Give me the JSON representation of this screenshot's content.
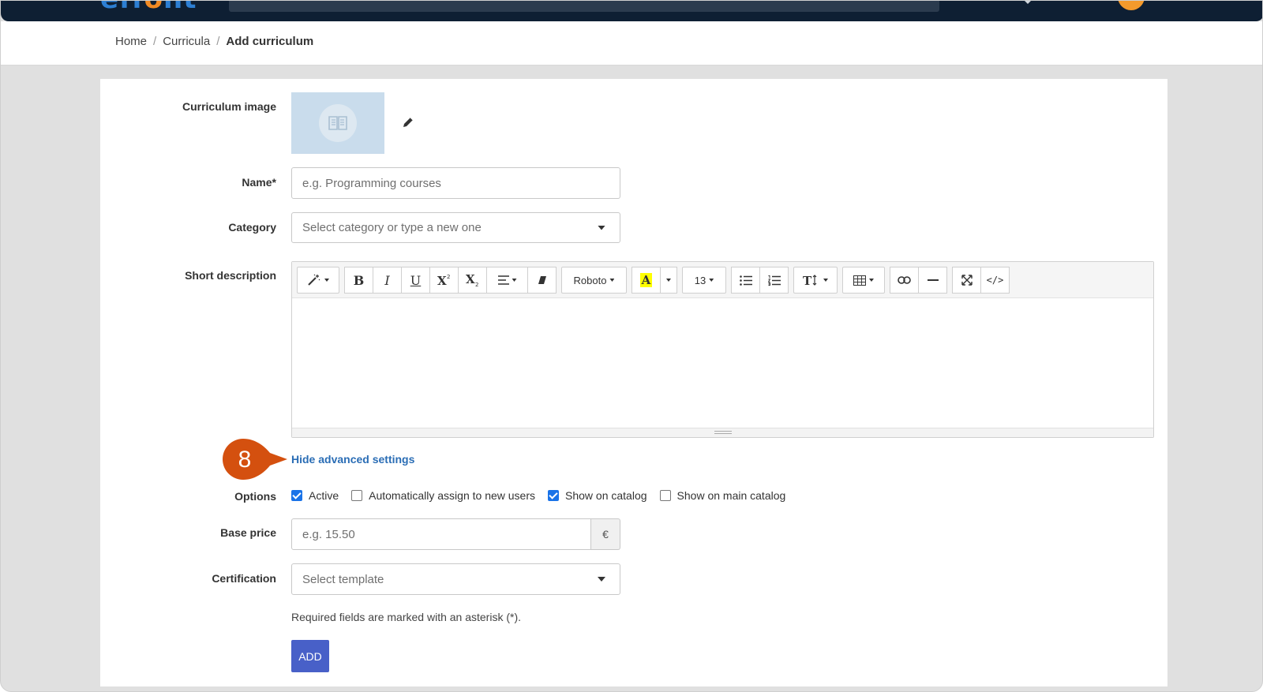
{
  "header": {
    "logo_text_a": "eff",
    "logo_text_o": "o",
    "logo_text_b": "nt"
  },
  "breadcrumb": {
    "items": [
      "Home",
      "Curricula"
    ],
    "separator": "/",
    "current": "Add curriculum"
  },
  "form": {
    "image_label": "Curriculum image",
    "name_label": "Name*",
    "name_placeholder": "e.g. Programming courses",
    "category_label": "Category",
    "category_placeholder": "Select category or type a new one",
    "description_label": "Short description",
    "toggle_advanced": "Hide advanced settings",
    "options_label": "Options",
    "options": [
      {
        "label": "Active",
        "checked": true
      },
      {
        "label": "Automatically assign to new users",
        "checked": false
      },
      {
        "label": "Show on catalog",
        "checked": true
      },
      {
        "label": "Show on main catalog",
        "checked": false
      }
    ],
    "price_label": "Base price",
    "price_placeholder": "e.g. 15.50",
    "currency": "€",
    "certification_label": "Certification",
    "certification_placeholder": "Select template",
    "required_note": "Required fields are marked with an asterisk (*).",
    "submit_label": "ADD"
  },
  "editor_toolbar": {
    "font_name": "Roboto",
    "font_size": "13",
    "bold": "B",
    "italic": "I",
    "underline": "U",
    "highlight": "A",
    "code": "</>"
  },
  "callout": {
    "step": "8",
    "color": "#d4500f"
  },
  "colors": {
    "link": "#2a6db5",
    "primary_button": "#4860c8",
    "checkbox": "#1a73e8",
    "topbar": "#0e1f33"
  }
}
